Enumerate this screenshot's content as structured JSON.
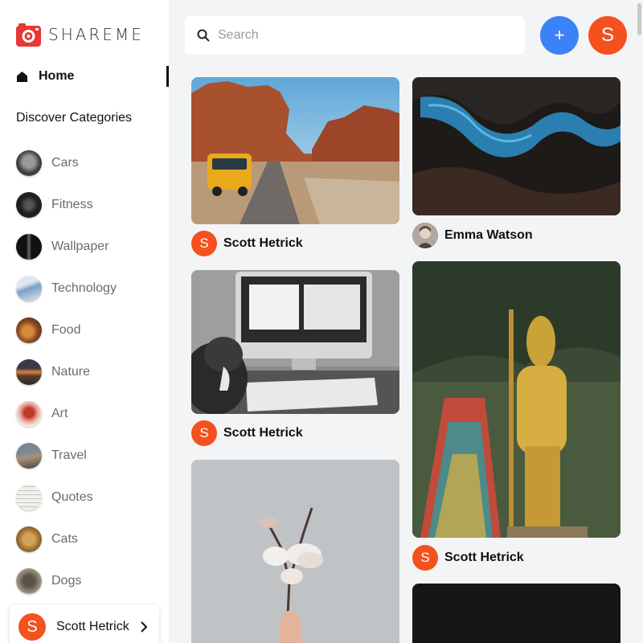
{
  "app": {
    "name": "SHAREME"
  },
  "nav": {
    "home_label": "Home"
  },
  "categories_heading": "Discover Categories",
  "categories": [
    {
      "label": "Cars"
    },
    {
      "label": "Fitness"
    },
    {
      "label": "Wallpaper"
    },
    {
      "label": "Technology"
    },
    {
      "label": "Food"
    },
    {
      "label": "Nature"
    },
    {
      "label": "Art"
    },
    {
      "label": "Travel"
    },
    {
      "label": "Quotes"
    },
    {
      "label": "Cats"
    },
    {
      "label": "Dogs"
    }
  ],
  "current_user": {
    "name": "Scott Hetrick",
    "initial": "S"
  },
  "search": {
    "placeholder": "Search",
    "value": ""
  },
  "add_button": {
    "label": "+"
  },
  "pins": [
    {
      "author": "Scott Hetrick",
      "initial": "S",
      "image": "desert-road-van"
    },
    {
      "author": "Scott Hetrick",
      "initial": "S",
      "image": "cat-at-computer"
    },
    {
      "author": "",
      "initial": "",
      "image": "hand-holding-flowers"
    },
    {
      "author": "Emma Watson",
      "initial": "",
      "image": "glowing-canyon"
    },
    {
      "author": "Scott Hetrick",
      "initial": "S",
      "image": "golden-statue-temple"
    },
    {
      "author": "",
      "initial": "",
      "image": "dark-photo"
    }
  ],
  "colors": {
    "accent_blue": "#3b82f6",
    "avatar_orange": "#f4511e",
    "brand_red": "#e53935"
  }
}
